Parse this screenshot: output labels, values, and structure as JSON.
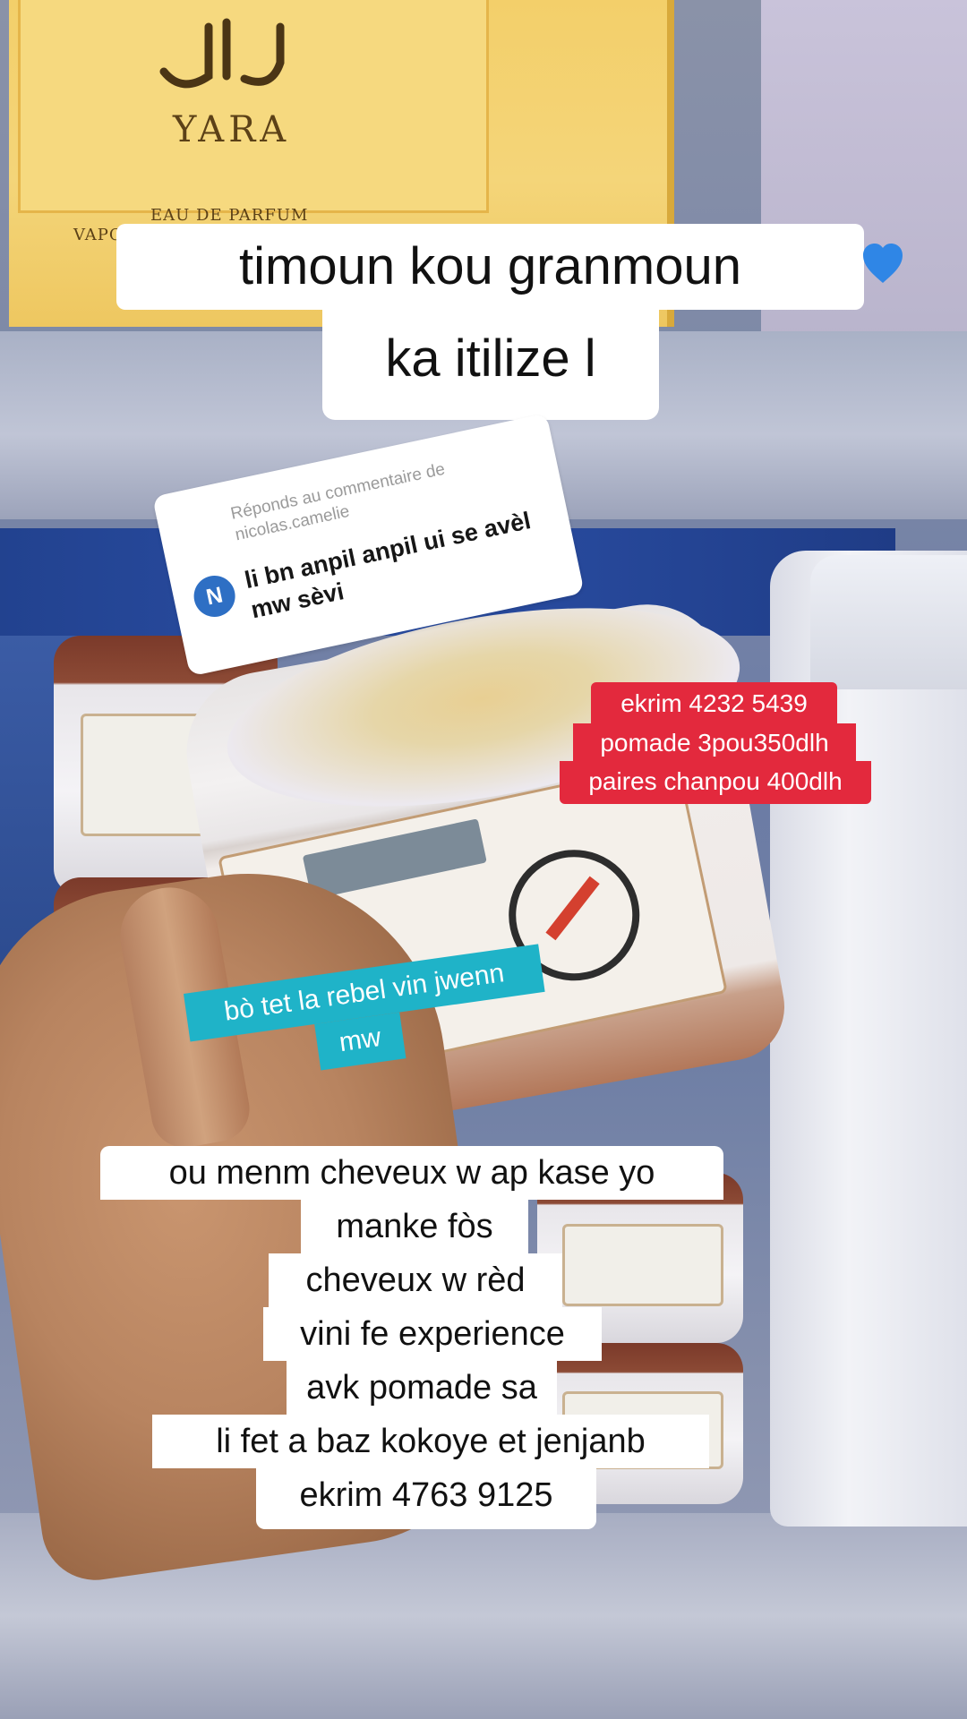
{
  "background": {
    "box_brand_arabic": "يارا",
    "box_brand": "YARA",
    "box_subtitle": "EAU DE PARFUM",
    "box_subtitle_2": "VAPO"
  },
  "caption": {
    "line1": "timoun kou granmoun",
    "line2": "ka itilize l",
    "emoji": "blue-heart-icon"
  },
  "reply": {
    "header": "Réponds au commentaire de nicolas.camelie",
    "avatar_letter": "N",
    "comment": "li bn anpil anpil ui se avèl mw sèvi"
  },
  "price_sticker": {
    "lines": [
      "ekrim 4232 5439",
      "pomade 3pou350dlh",
      "paires chanpou 400dlh"
    ],
    "color": "#e3293d"
  },
  "cyan_sticker": {
    "line1": "bò tet la rebel vin jwenn",
    "line2": "mw",
    "color": "#1fb3c8"
  },
  "body_text": {
    "lines": [
      "ou menm cheveux w ap kase yo",
      "manke fòs",
      "cheveux w rèd",
      "vini fe experience",
      "avk pomade sa",
      "li fet a baz kokoye et jenjanb",
      "ekrim 4763 9125"
    ]
  }
}
